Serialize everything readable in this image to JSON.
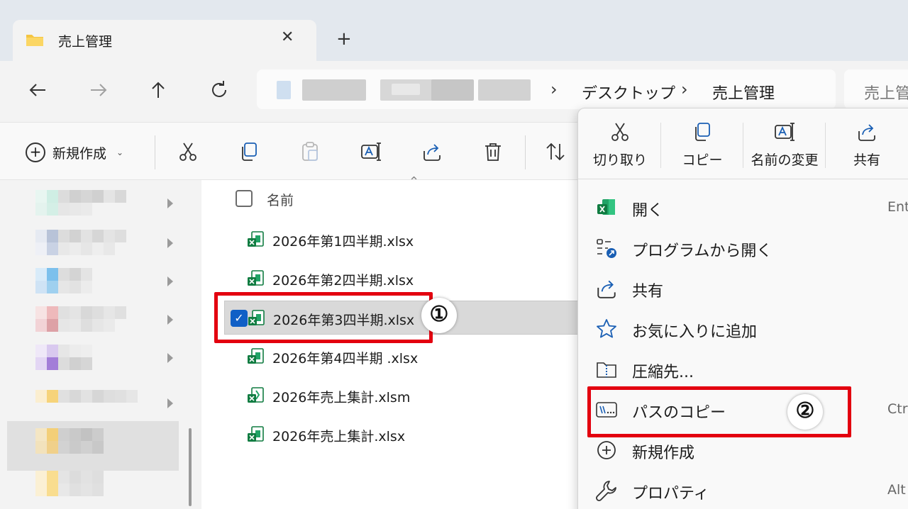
{
  "tab": {
    "title": "売上管理",
    "close": "✕"
  },
  "newtab": "+",
  "breadcrumb": [
    "デスクトップ",
    "売上管理"
  ],
  "search": {
    "placeholder": "売上管"
  },
  "commandbar": {
    "new_label": "新規作成"
  },
  "filelist": {
    "header_name": "名前",
    "files": [
      {
        "name": "2026年第1四半期.xlsx",
        "selected": false
      },
      {
        "name": "2026年第2四半期.xlsx",
        "selected": false
      },
      {
        "name": "2026年第3四半期.xlsx",
        "selected": true
      },
      {
        "name": "2026年第4四半期 .xlsx",
        "selected": false
      },
      {
        "name": "2026年売上集計.xlsm",
        "selected": false
      },
      {
        "name": "2026年売上集計.xlsx",
        "selected": false
      }
    ]
  },
  "contextmenu": {
    "top": [
      {
        "label": "切り取り",
        "icon": "scissors-icon"
      },
      {
        "label": "コピー",
        "icon": "copy-icon"
      },
      {
        "label": "名前の変更",
        "icon": "rename-icon"
      },
      {
        "label": "共有",
        "icon": "share-icon"
      }
    ],
    "items": [
      {
        "label": "開く",
        "shortcut": "Ent",
        "icon": "excel-icon"
      },
      {
        "label": "プログラムから開く",
        "shortcut": "",
        "icon": "open-with-icon"
      },
      {
        "label": "共有",
        "shortcut": "",
        "icon": "share-icon"
      },
      {
        "label": "お気に入りに追加",
        "shortcut": "",
        "icon": "star-icon"
      },
      {
        "label": "圧縮先...",
        "shortcut": "",
        "icon": "zip-folder-icon"
      },
      {
        "label": "パスのコピー",
        "shortcut": "Ctrl",
        "icon": "copy-path-icon"
      },
      {
        "label": "新規作成",
        "shortcut": "",
        "icon": "plus-circle-icon"
      },
      {
        "label": "プロパティ",
        "shortcut": "Alt",
        "icon": "wrench-icon"
      }
    ]
  },
  "annotations": {
    "step1": "①",
    "step2": "②"
  },
  "colors": {
    "highlight": "#e3000f",
    "checkbox": "#0f5fc6",
    "excel": "#107c41"
  }
}
